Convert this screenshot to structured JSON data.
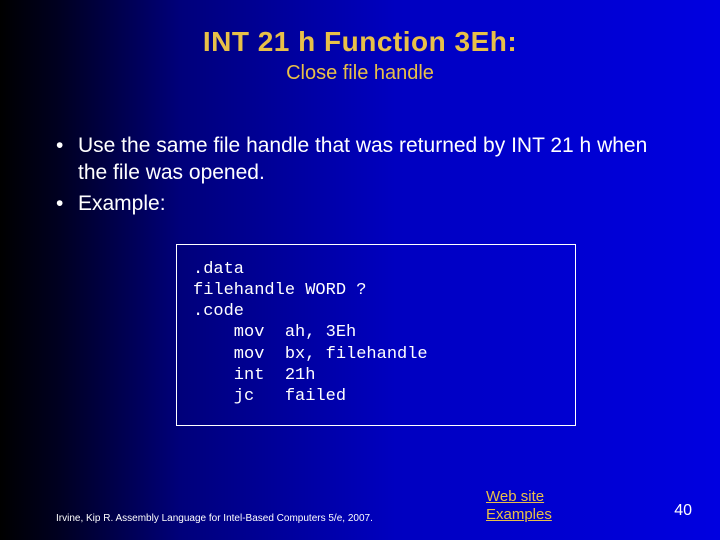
{
  "title": "INT 21 h Function 3Eh:",
  "subtitle": "Close file handle",
  "bullets": [
    "Use the same file handle that was returned by INT 21 h when the file was opened.",
    "Example:"
  ],
  "code": ".data\nfilehandle WORD ?\n.code\n    mov  ah, 3Eh\n    mov  bx, filehandle\n    int  21h\n    jc   failed",
  "footer": {
    "citation": "Irvine, Kip R. Assembly Language for Intel-Based Computers 5/e, 2007.",
    "link_web": "Web site",
    "link_examples": "Examples",
    "page": "40"
  }
}
